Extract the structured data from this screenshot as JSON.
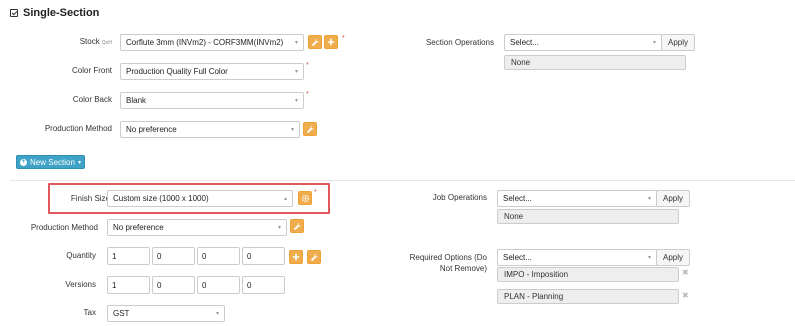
{
  "header": {
    "title": "Single-Section"
  },
  "top": {
    "stock": {
      "label": "Stock",
      "qoh": "QoH",
      "value": "Corflute 3mm (INVm2) - CORF3MM(INVm2)"
    },
    "color_front": {
      "label": "Color Front",
      "value": "Production Quality Full Color"
    },
    "color_back": {
      "label": "Color Back",
      "value": "Blank"
    },
    "production_method": {
      "label": "Production Method",
      "value": "No preference"
    },
    "section_operations": {
      "label": "Section Operations",
      "placeholder": "Select...",
      "apply": "Apply",
      "selected": "None"
    },
    "required_star": "*"
  },
  "new_section": {
    "label": "New Section"
  },
  "bottom": {
    "finish_size": {
      "label": "Finish Size",
      "value": "Custom size (1000 x 1000)"
    },
    "production_method": {
      "label": "Production Method",
      "value": "No preference"
    },
    "quantity": {
      "label": "Quantity",
      "values": [
        "1",
        "0",
        "0",
        "0"
      ]
    },
    "versions": {
      "label": "Versions",
      "values": [
        "1",
        "0",
        "0",
        "0"
      ]
    },
    "tax": {
      "label": "Tax",
      "value": "GST"
    },
    "job_operations": {
      "label": "Job Operations",
      "placeholder": "Select...",
      "apply": "Apply",
      "selected": "None"
    },
    "required_options": {
      "label_line1": "Required Options (Do",
      "label_line2": "Not Remove)",
      "placeholder": "Select...",
      "apply": "Apply",
      "tags": [
        "IMPO - Imposition",
        "PLAN - Planning"
      ]
    }
  },
  "icons": {
    "wrench": "wrench-icon",
    "plus": "plus-icon",
    "gear": "gear-icon",
    "caret": "chevron-down-icon",
    "remove": "close-icon"
  },
  "colors": {
    "accent_orange": "#f0ad4e",
    "button_blue": "#3fa3c7",
    "highlight_red": "#e0575c"
  }
}
